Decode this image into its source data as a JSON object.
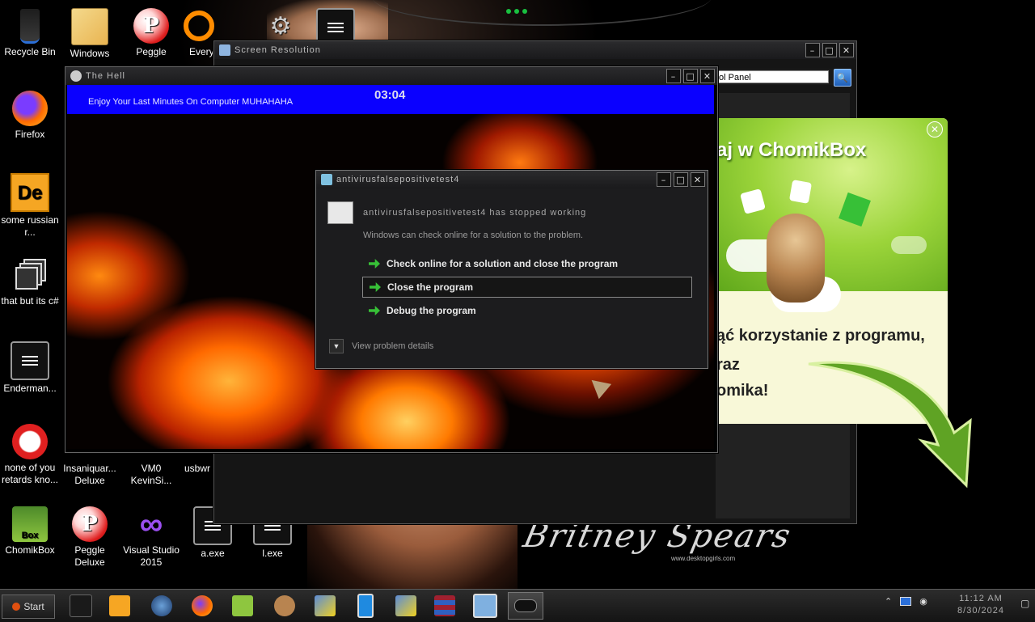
{
  "desktop_icons": [
    {
      "label": "Recycle Bin",
      "icon": "recycle-bin-icon"
    },
    {
      "label": "Windows",
      "icon": "windows-icon"
    },
    {
      "label": "Peggle",
      "icon": "peggle-icon"
    },
    {
      "label": "Every",
      "icon": "everything-search-icon"
    },
    {
      "label": "Firefox",
      "icon": "firefox-icon"
    },
    {
      "label": "some russian r...",
      "icon": "de-app-icon"
    },
    {
      "label": "that but its c#",
      "icon": "copies-icon"
    },
    {
      "label": "Enderman...",
      "icon": "terminal-icon"
    },
    {
      "label": "none of you retards kno...",
      "icon": "dino-icon"
    },
    {
      "label": "Insaniquar... Deluxe",
      "icon": "insaniquarium-icon"
    },
    {
      "label": "VM0 KevinSi...",
      "icon": "vm-icon"
    },
    {
      "label": "usbwr",
      "icon": "usb-icon"
    },
    {
      "label": "ChomikBox",
      "icon": "chomikbox-icon"
    },
    {
      "label": "Peggle Deluxe",
      "icon": "peggle-deluxe-icon"
    },
    {
      "label": "Visual Studio 2015",
      "icon": "visual-studio-icon"
    },
    {
      "label": "a.exe",
      "icon": "terminal-icon"
    },
    {
      "label": "l.exe",
      "icon": "terminal-icon"
    }
  ],
  "screen_resolution_window": {
    "title": "Screen Resolution",
    "search_value": "ol Panel"
  },
  "hell_window": {
    "title": "The Hell",
    "message": "Enjoy Your Last Minutes On Computer MUHAHAHA",
    "timer": "03:04",
    "banner_color": "#0a00ff"
  },
  "error_dialog": {
    "title": "antivirusfalsepositivetest4",
    "heading": "antivirusfalsepositivetest4 has stopped working",
    "subtext": "Windows can check online for a solution to the problem.",
    "options": [
      "Check online for a solution and close the program",
      "Close the program",
      "Debug the program"
    ],
    "selected_option": 1,
    "details_label": "View problem details"
  },
  "chomik_ad": {
    "title": "aj w ChomikBox",
    "line1": "ąć korzystanie z programu,",
    "line2": "raz",
    "line3": "omika!",
    "accent_color": "#8ec63f"
  },
  "wallpaper": {
    "signature": "Britney Spears",
    "credit": "www.desktopgirls.com"
  },
  "taskbar": {
    "start_label": "Start",
    "items": [
      "cmd-icon",
      "media-player-icon",
      "globe-icon",
      "firefox-icon",
      "chomikbox-icon",
      "hamster-icon",
      "warning-app-icon",
      "phone-icon",
      "warning-app-icon",
      "winrar-icon",
      "monitor-icon",
      "gamepad-icon"
    ],
    "active_index": 11,
    "clock_time": "11:12 AM",
    "clock_date": "8/30/2024"
  }
}
